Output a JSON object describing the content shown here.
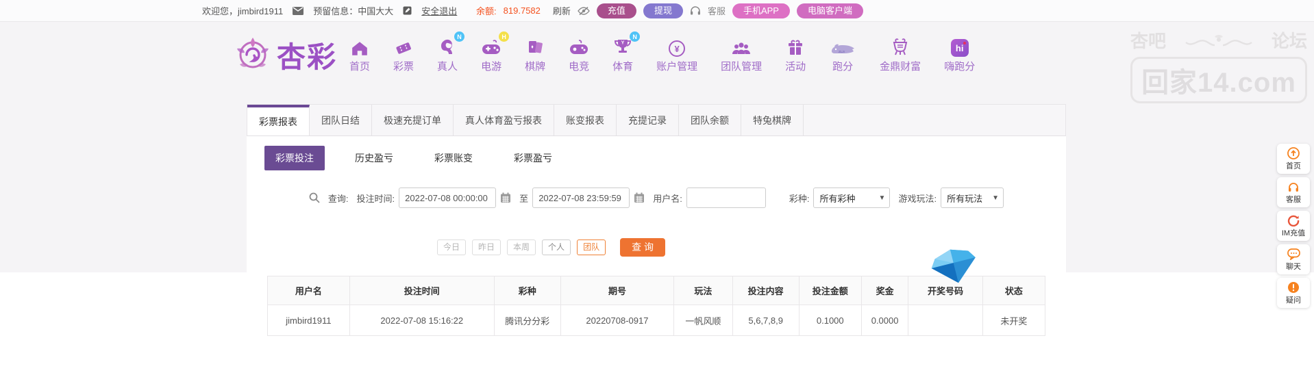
{
  "topbar": {
    "welcome": "欢迎您，jimbird1911",
    "reserved_info": "预留信息：中国大大",
    "logout": "安全退出",
    "balance_label": "余额:",
    "balance_value": "819.7582",
    "refresh": "刷新",
    "deposit": "充值",
    "withdraw": "提现",
    "service": "客服",
    "mobile_app": "手机APP",
    "pc_client": "电脑客户端"
  },
  "brand": {
    "logo_text": "杏彩"
  },
  "nav": {
    "coin_glyph": "¥",
    "hi_glyph": "hi",
    "items": [
      {
        "label": "首页",
        "badge": ""
      },
      {
        "label": "彩票",
        "badge": ""
      },
      {
        "label": "真人",
        "badge": "N"
      },
      {
        "label": "电游",
        "badge": "H"
      },
      {
        "label": "棋牌",
        "badge": ""
      },
      {
        "label": "电竞",
        "badge": ""
      },
      {
        "label": "体育",
        "badge": "N"
      },
      {
        "label": "账户管理",
        "badge": ""
      },
      {
        "label": "团队管理",
        "badge": ""
      },
      {
        "label": "活动",
        "badge": ""
      },
      {
        "label": "跑分",
        "badge": ""
      },
      {
        "label": "金鼎财富",
        "badge": ""
      },
      {
        "label": "嗨跑分",
        "badge": ""
      }
    ]
  },
  "watermark": {
    "left": "杏吧",
    "right": "论坛",
    "domain": "回家14.com"
  },
  "tabs": {
    "active_index": 0,
    "items": [
      {
        "label": "彩票报表"
      },
      {
        "label": "团队日结"
      },
      {
        "label": "极速充提订单"
      },
      {
        "label": "真人体育盈亏报表"
      },
      {
        "label": "账变报表"
      },
      {
        "label": "充提记录"
      },
      {
        "label": "团队余额"
      },
      {
        "label": "特兔棋牌"
      }
    ]
  },
  "subtabs": {
    "active_index": 0,
    "items": [
      {
        "label": "彩票投注"
      },
      {
        "label": "历史盈亏"
      },
      {
        "label": "彩票账变"
      },
      {
        "label": "彩票盈亏"
      }
    ]
  },
  "query": {
    "search_label": "查询:",
    "bet_time_label": "投注时间:",
    "start_value": "2022-07-08 00:00:00",
    "to_label": "至",
    "end_value": "2022-07-08 23:59:59",
    "username_label": "用户名:",
    "username_value": "",
    "lottery_label": "彩种:",
    "lottery_value": "所有彩种",
    "play_label": "游戏玩法:",
    "play_value": "所有玩法"
  },
  "quick_buttons": {
    "today": "今日",
    "yesterday": "昨日",
    "this_week": "本周",
    "personal": "个人",
    "team": "团队",
    "search": "查 询"
  },
  "table": {
    "headers": [
      "用户名",
      "投注时间",
      "彩种",
      "期号",
      "玩法",
      "投注内容",
      "投注金额",
      "奖金",
      "开奖号码",
      "状态"
    ],
    "rows": [
      [
        "jimbird1911",
        "2022-07-08 15:16:22",
        "腾讯分分彩",
        "20220708-0917",
        "一帆风顺",
        "5,6,7,8,9",
        "0.1000",
        "0.0000",
        "",
        "未开奖"
      ]
    ]
  },
  "floating": {
    "items": [
      {
        "label": "首页"
      },
      {
        "label": "客服"
      },
      {
        "label": "IM充值"
      },
      {
        "label": "聊天"
      },
      {
        "label": "疑问"
      }
    ]
  },
  "colors": {
    "accent_purple": "#6a4b93",
    "nav_purple": "#a55cc2",
    "accent_orange": "#ee7331",
    "balance_orange": "#f4511e",
    "status_green": "#2f9e44"
  }
}
